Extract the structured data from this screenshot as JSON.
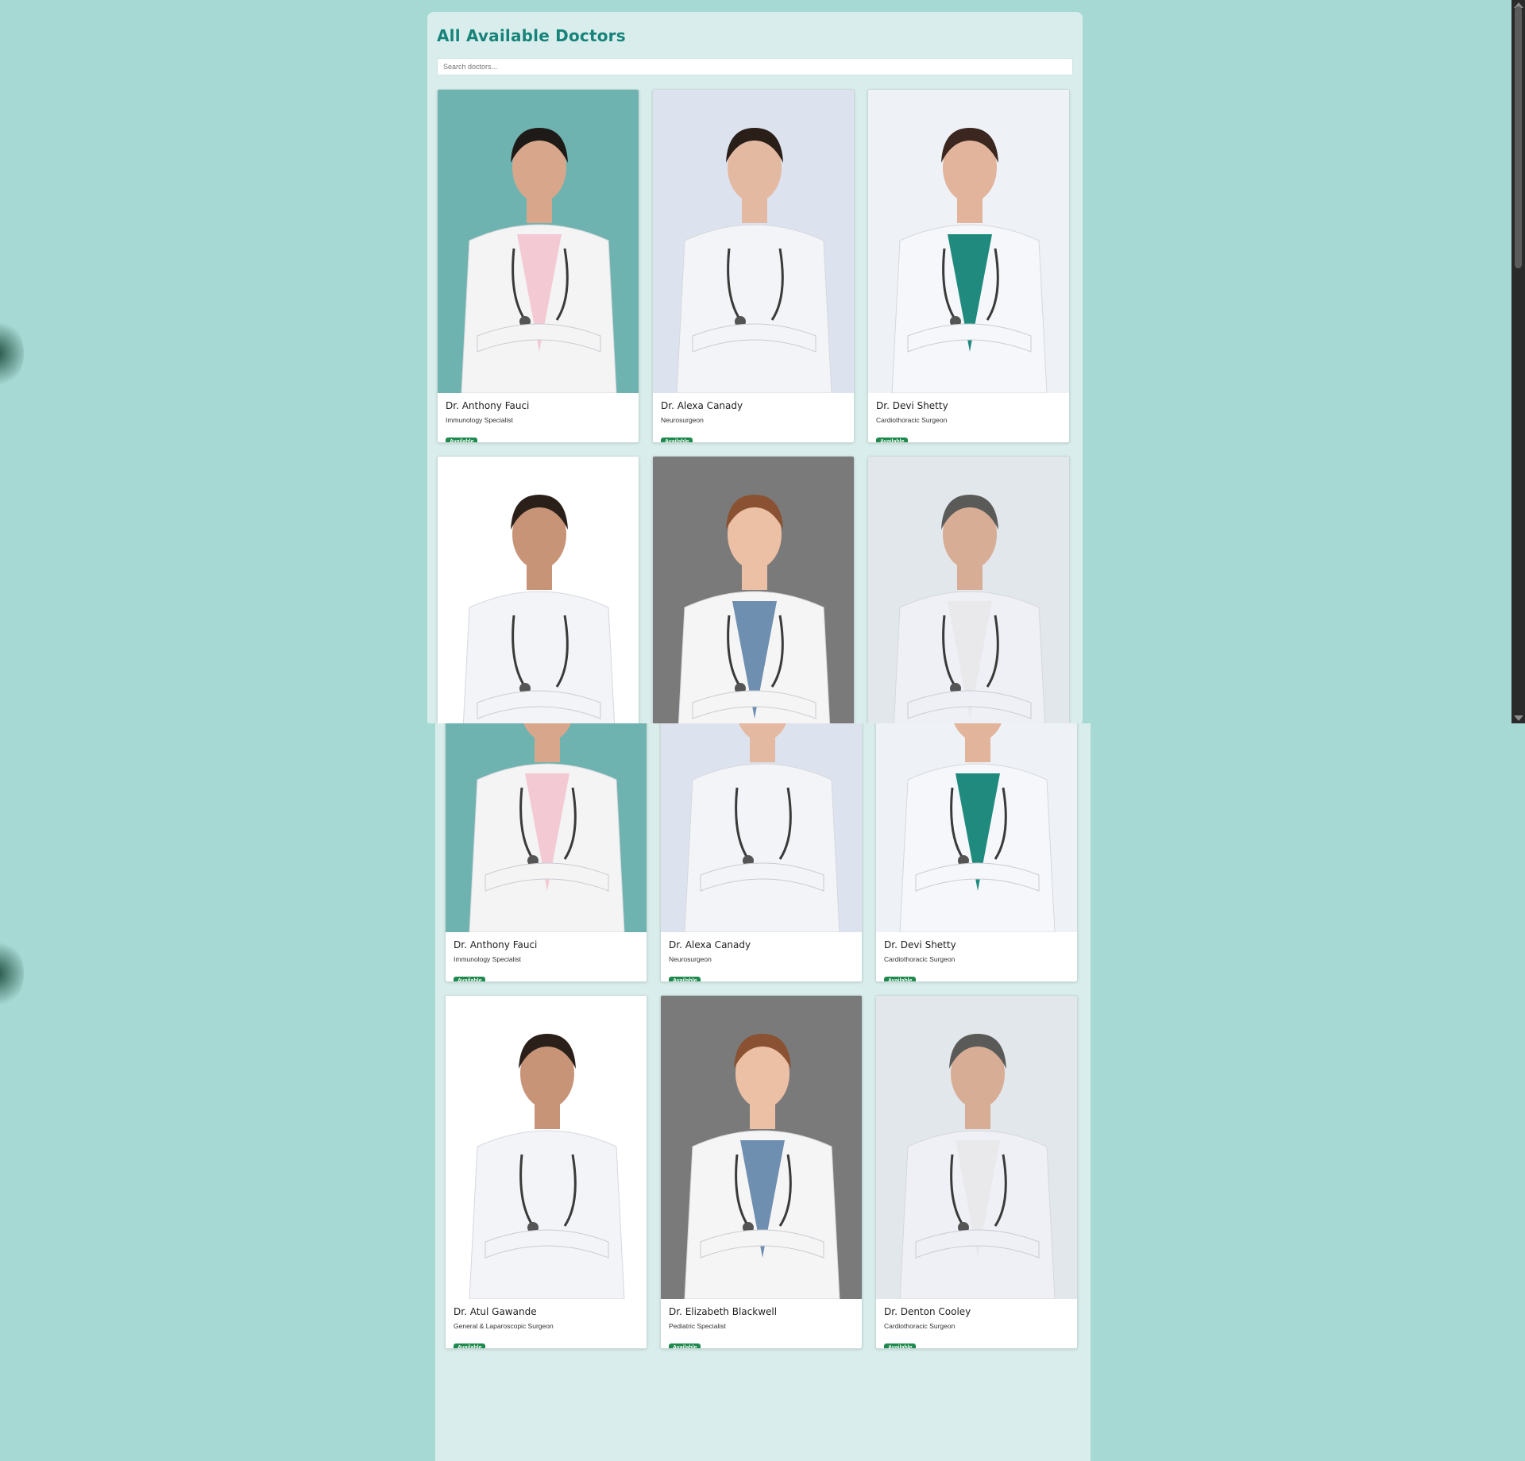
{
  "page": {
    "title": "All Available Doctors",
    "search_placeholder": "Search doctors..."
  },
  "doctors": [
    {
      "name": "Dr. Anthony Fauci",
      "specialty": "Immunology Specialist",
      "status": "Available",
      "photo_bg": "#6fb3b0",
      "coat": "#f4f4f4",
      "scrub": "#f3c9d3",
      "hair": "#1e1a17",
      "skin": "#d8a78b"
    },
    {
      "name": "Dr. Alexa Canady",
      "specialty": "Neurosurgeon",
      "status": "Available",
      "photo_bg": "#dde2ef",
      "coat": "#f2f4f7",
      "scrub": "#f2f4f7",
      "hair": "#2a1e19",
      "skin": "#e4b9a2"
    },
    {
      "name": "Dr. Devi Shetty",
      "specialty": "Cardiothoracic Surgeon",
      "status": "Available",
      "photo_bg": "#eef2f7",
      "coat": "#f5f7fa",
      "scrub": "#1f8a7d",
      "hair": "#3b2720",
      "skin": "#e2b49b"
    },
    {
      "name": "Dr. Atul Gawande",
      "specialty": "General & Laparoscopic Surgeon",
      "status": "Available",
      "photo_bg": "#ffffff",
      "coat": "#f3f4f8",
      "scrub": "#f3f4f8",
      "hair": "#2a2019",
      "skin": "#c89478"
    },
    {
      "name": "Dr. Elizabeth Blackwell",
      "specialty": "Pediatric Specialist",
      "status": "Available",
      "photo_bg": "#7a7a7a",
      "coat": "#f5f5f5",
      "scrub": "#6f8fb0",
      "hair": "#8a5232",
      "skin": "#ecc0a4"
    },
    {
      "name": "Dr. Denton Cooley",
      "specialty": "Cardiothoracic Surgeon",
      "status": "Available",
      "photo_bg": "#e2e7ec",
      "coat": "#eef0f6",
      "scrub": "#e9e9ec",
      "hair": "#5a5a58",
      "skin": "#d8ad95"
    }
  ]
}
